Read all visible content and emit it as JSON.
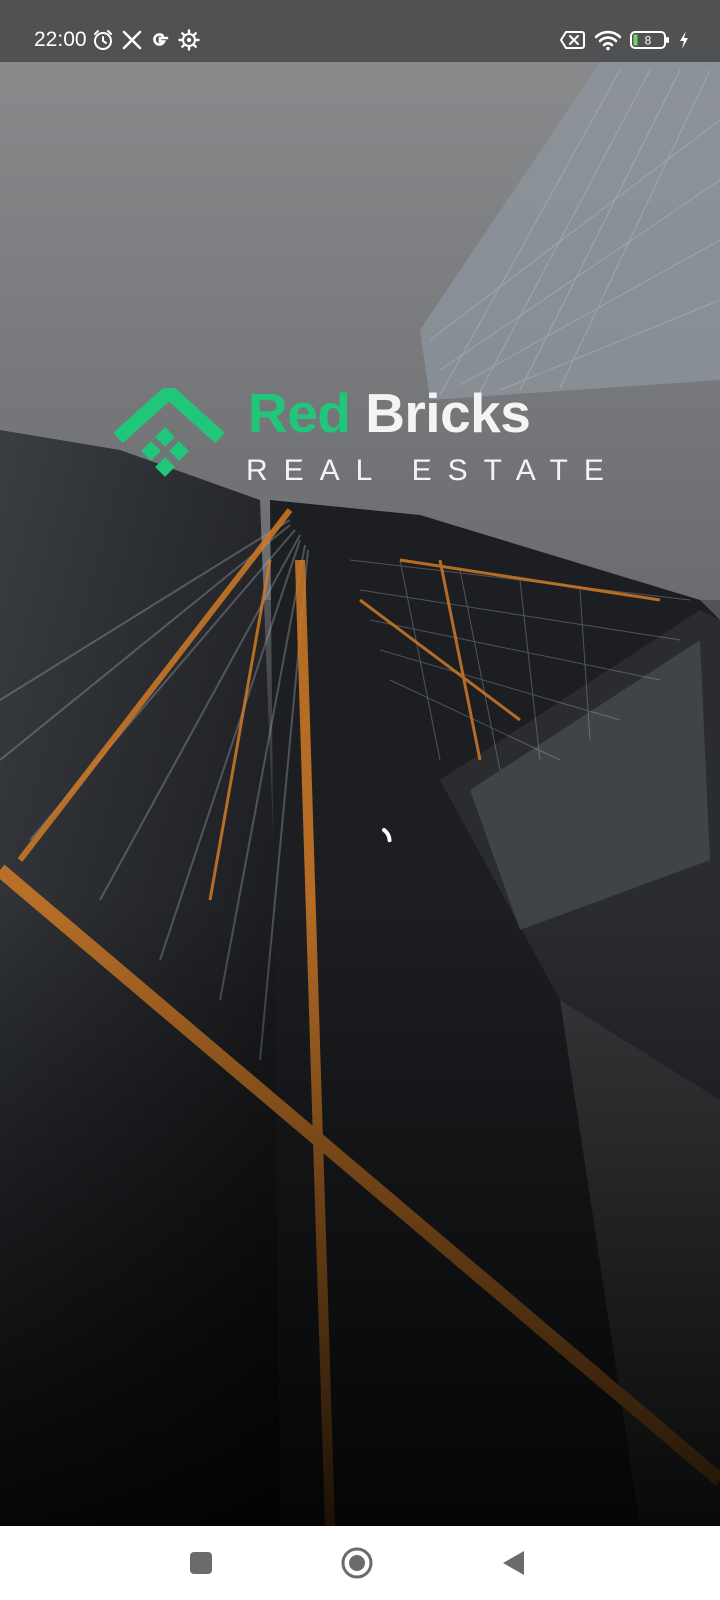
{
  "status_bar": {
    "time": "22:00",
    "left_icons": [
      "alarm-icon",
      "x-logo-icon",
      "google-icon",
      "settings-gear-icon"
    ],
    "right_icons": [
      "no-sim-icon",
      "wifi-icon",
      "battery-icon",
      "charging-bolt-icon"
    ],
    "battery_level": "8",
    "background_color": "#464648"
  },
  "splash": {
    "brand_first": "Red",
    "brand_second": "Bricks",
    "tagline": "REAL ESTATE",
    "accent_color": "#20c77a",
    "text_color": "#f4f4f4",
    "loading": true
  },
  "nav_bar": {
    "buttons": [
      "recent-apps-button",
      "home-button",
      "back-button"
    ],
    "background_color": "#ffffff",
    "icon_color": "#6b6b6b"
  }
}
